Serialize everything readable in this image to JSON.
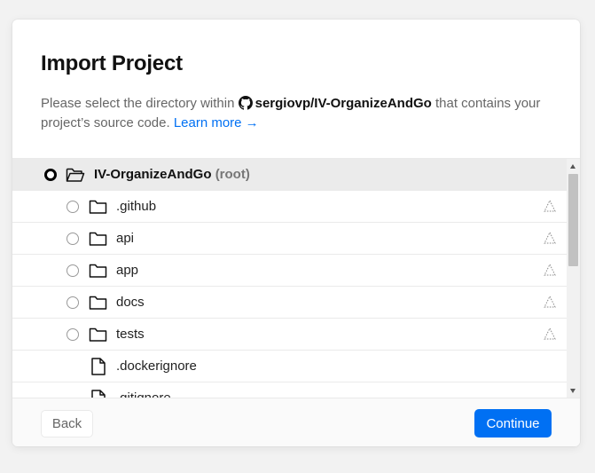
{
  "dialog": {
    "title": "Import Project",
    "desc_prefix": "Please select the directory within",
    "repo_name": "sergiovp/IV-OrganizeAndGo",
    "desc_suffix": "that contains your project’s source code.",
    "learn_more": "Learn more →"
  },
  "tree": {
    "root": {
      "name": "IV-OrganizeAndGo",
      "suffix": "(root)",
      "selected": true
    },
    "items": [
      {
        "name": ".github",
        "type": "folder",
        "selectable": true,
        "warning": true
      },
      {
        "name": "api",
        "type": "folder",
        "selectable": true,
        "warning": true
      },
      {
        "name": "app",
        "type": "folder",
        "selectable": true,
        "warning": true
      },
      {
        "name": "docs",
        "type": "folder",
        "selectable": true,
        "warning": true
      },
      {
        "name": "tests",
        "type": "folder",
        "selectable": true,
        "warning": true
      },
      {
        "name": ".dockerignore",
        "type": "file",
        "selectable": false,
        "warning": false
      },
      {
        "name": ".gitignore",
        "type": "file",
        "selectable": false,
        "warning": false
      }
    ]
  },
  "footer": {
    "back_label": "Back",
    "continue_label": "Continue"
  },
  "colors": {
    "accent": "#0070f3",
    "root_row_bg": "#ebebeb"
  },
  "icons": {
    "repo": "github-icon",
    "folder": "folder-icon",
    "folder_open": "folder-open-icon",
    "file": "file-icon",
    "warning": "warning-icon"
  }
}
